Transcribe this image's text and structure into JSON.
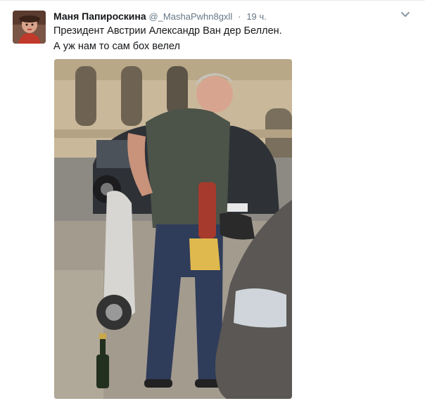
{
  "tweet": {
    "author_name": "Маня Папироскина",
    "author_handle": "@_MashaPwhn8gxll",
    "separator": "·",
    "time": "19 ч.",
    "text_lines": [
      "Президент Австрии Александр Ван дер Беллен.",
      "А уж нам то сам бох велел"
    ],
    "menu_icon": "chevron-down-icon",
    "media": "photo"
  }
}
